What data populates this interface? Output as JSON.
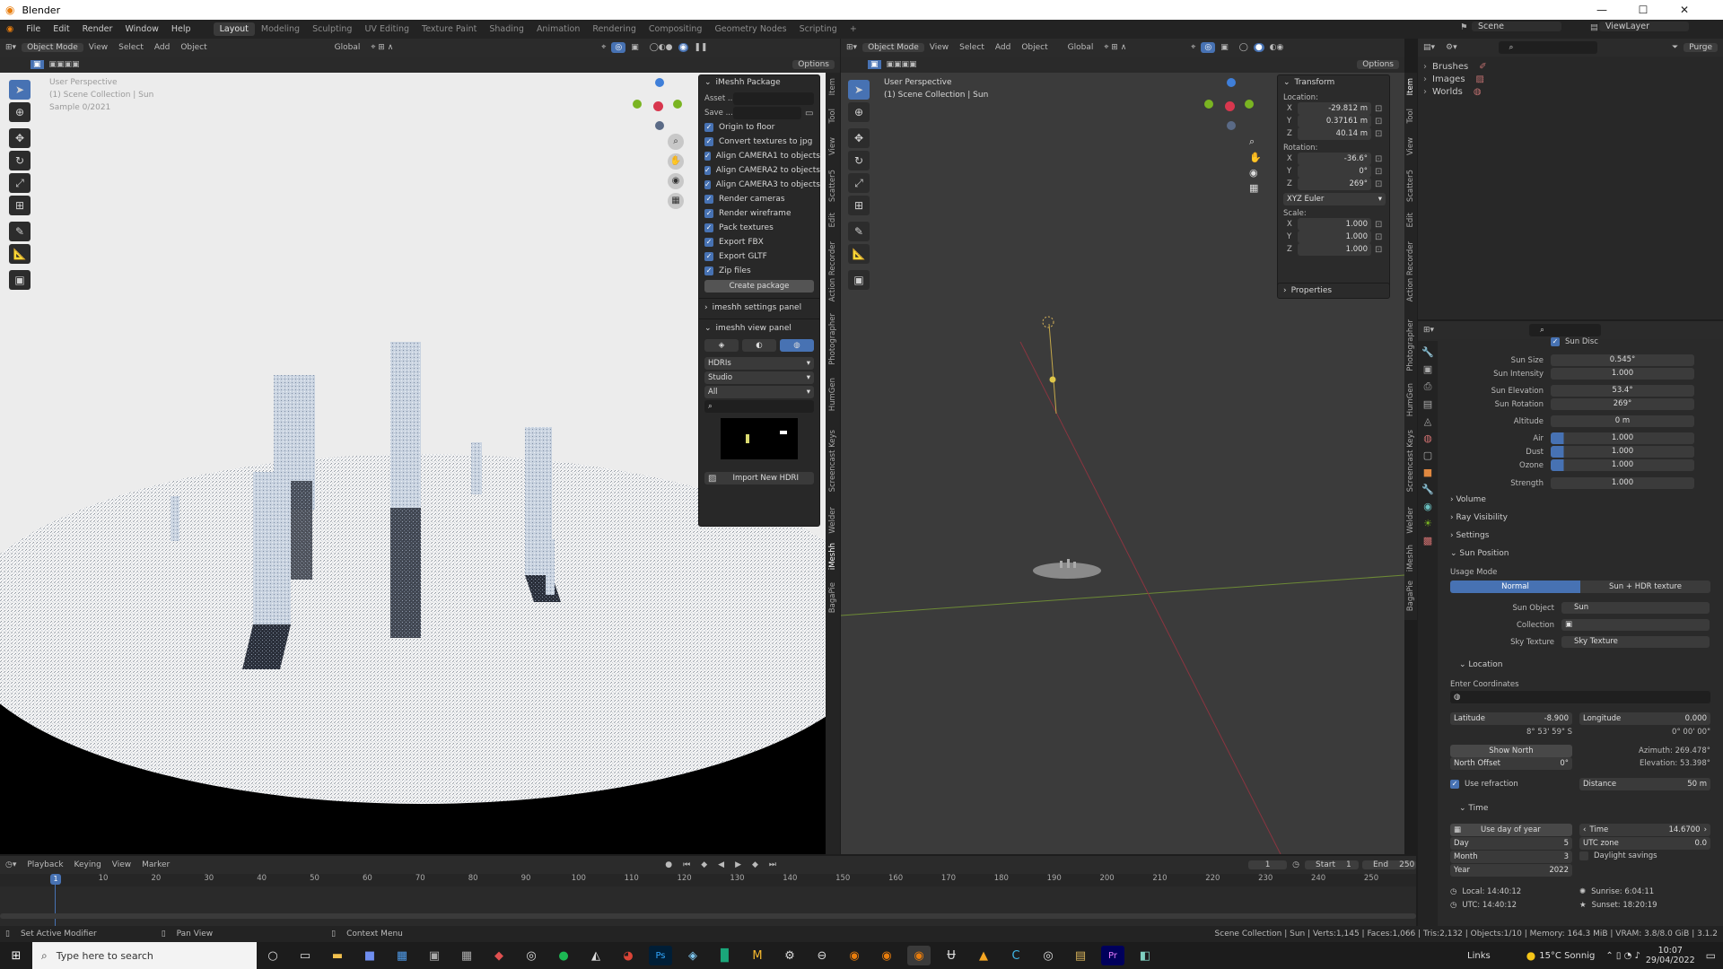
{
  "window": {
    "title": "Blender",
    "minimize": "—",
    "maximize": "☐",
    "close": "✕"
  },
  "menu": {
    "items": [
      "File",
      "Edit",
      "Render",
      "Window",
      "Help"
    ],
    "workspaces": [
      "Layout",
      "Modeling",
      "Sculpting",
      "UV Editing",
      "Texture Paint",
      "Shading",
      "Animation",
      "Rendering",
      "Compositing",
      "Geometry Nodes",
      "Scripting",
      "+"
    ],
    "scene": "Scene",
    "view_layer": "ViewLayer"
  },
  "left_viewport": {
    "header": {
      "mode": "Object Mode",
      "menus": [
        "View",
        "Select",
        "Add",
        "Object"
      ],
      "orientation": "Global",
      "options": "Options"
    },
    "overlay": {
      "line1": "User Perspective",
      "line2": "(1) Scene Collection | Sun",
      "line3": "Sample 0/2021"
    }
  },
  "imeshh": {
    "title": "iMeshh Package",
    "asset_label": "Asset ...",
    "save_label": "Save ...",
    "options": [
      "Origin to floor",
      "Convert textures to jpg",
      "Align CAMERA1 to objects",
      "Align CAMERA2 to objects",
      "Align CAMERA3 to objects",
      "Render cameras",
      "Render wireframe",
      "Pack textures",
      "Export FBX",
      "Export GLTF",
      "Zip files"
    ],
    "create_button": "Create package",
    "settings_panel": "imeshh settings panel",
    "view_panel": "imeshh view panel",
    "hdri_select": "HDRIs",
    "studio_select": "Studio",
    "all_select": "All",
    "import_button": "Import New HDRI"
  },
  "left_tabs": [
    "Item",
    "Tool",
    "View",
    "Scatter5",
    "Edit",
    "Action Recorder",
    "Photographer",
    "HumGen",
    "Screencast Keys",
    "Welder",
    "iMeshh",
    "BagaPie"
  ],
  "right_viewport": {
    "header": {
      "mode": "Object Mode",
      "menus": [
        "View",
        "Select",
        "Add",
        "Object"
      ],
      "orientation": "Global",
      "options": "Options"
    },
    "overlay": {
      "line1": "User Perspective",
      "line2": "(1) Scene Collection | Sun"
    }
  },
  "transform": {
    "title": "Transform",
    "location_label": "Location:",
    "location": [
      {
        "axis": "X",
        "value": "-29.812 m"
      },
      {
        "axis": "Y",
        "value": "0.37161 m"
      },
      {
        "axis": "Z",
        "value": "40.14 m"
      }
    ],
    "rotation_label": "Rotation:",
    "rotation": [
      {
        "axis": "X",
        "value": "-36.6°"
      },
      {
        "axis": "Y",
        "value": "0°"
      },
      {
        "axis": "Z",
        "value": "269°"
      }
    ],
    "rotation_mode": "XYZ Euler",
    "scale_label": "Scale:",
    "scale": [
      {
        "axis": "X",
        "value": "1.000"
      },
      {
        "axis": "Y",
        "value": "1.000"
      },
      {
        "axis": "Z",
        "value": "1.000"
      }
    ],
    "properties": "Properties"
  },
  "right_tabs": [
    "Item",
    "Tool",
    "View",
    "Scatter5",
    "Edit",
    "Action Recorder",
    "Photographer",
    "HumGen",
    "Screencast Keys",
    "Welder",
    "iMeshh",
    "BagaPie"
  ],
  "outliner": {
    "items": [
      "Brushes",
      "Images",
      "Worlds"
    ],
    "purge": "Purge"
  },
  "props": {
    "sun_disc": "Sun Disc",
    "rows": [
      {
        "label": "Sun Size",
        "value": "0.545°"
      },
      {
        "label": "Sun Intensity",
        "value": "1.000"
      },
      {
        "label": "Sun Elevation",
        "value": "53.4°"
      },
      {
        "label": "Sun Rotation",
        "value": "269°"
      },
      {
        "label": "Altitude",
        "value": "0 m"
      },
      {
        "label": "Air",
        "value": "1.000"
      },
      {
        "label": "Dust",
        "value": "1.000"
      },
      {
        "label": "Ozone",
        "value": "1.000"
      },
      {
        "label": "Strength",
        "value": "1.000"
      }
    ],
    "sections": [
      "Volume",
      "Ray Visibility",
      "Settings",
      "Sun Position"
    ],
    "usage_mode_label": "Usage Mode",
    "usage_normal": "Normal",
    "usage_hdr": "Sun + HDR texture",
    "sun_object_label": "Sun Object",
    "sun_object": "Sun",
    "collection_label": "Collection",
    "sky_texture_label": "Sky Texture",
    "sky_texture": "Sky Texture",
    "location_section": "Location",
    "enter_coordinates": "Enter Coordinates",
    "latitude_label": "Latitude",
    "latitude": "-8.900",
    "latitude_dms": "8° 53' 59\" S",
    "longitude_label": "Longitude",
    "longitude": "0.000",
    "longitude_dms": "0° 00' 00\"",
    "show_north": "Show North",
    "north_offset_label": "North Offset",
    "north_offset": "0°",
    "azimuth": "Azimuth: 269.478°",
    "elevation": "Elevation: 53.398°",
    "use_refraction": "Use refraction",
    "distance_label": "Distance",
    "distance": "50 m",
    "time_section": "Time",
    "use_day_of_year": "Use day of year",
    "day_label": "Day",
    "day": "5",
    "month_label": "Month",
    "month": "3",
    "year_label": "Year",
    "year": "2022",
    "time_label": "Time",
    "time": "14.6700",
    "utc_zone_label": "UTC zone",
    "utc_zone": "0.0",
    "daylight_savings": "Daylight savings",
    "local": "Local: 14:40:12",
    "utc": "UTC: 14:40:12",
    "sunrise": "Sunrise: 6:04:11",
    "sunset": "Sunset: 18:20:19"
  },
  "timeline": {
    "menus": [
      "Playback",
      "Keying",
      "View",
      "Marker"
    ],
    "current_frame": "1",
    "start_label": "Start",
    "start": "1",
    "end_label": "End",
    "end": "250",
    "ticks": [
      "1",
      "10",
      "20",
      "30",
      "40",
      "50",
      "60",
      "70",
      "80",
      "90",
      "100",
      "110",
      "120",
      "130",
      "140",
      "150",
      "160",
      "170",
      "180",
      "190",
      "200",
      "210",
      "220",
      "230",
      "240",
      "250"
    ]
  },
  "status": {
    "left1": "Set Active Modifier",
    "left2": "Pan View",
    "left3": "Context Menu",
    "right": "Scene Collection | Sun | Verts:1,145 | Faces:1,066 | Tris:2,132 | Objects:1/10 | Memory: 164.3 MiB | VRAM: 3.8/8.0 GiB | 3.1.2"
  },
  "taskbar": {
    "search_placeholder": "Type here to search",
    "links": "Links",
    "weather": "15°C Sonnig",
    "time": "10:07",
    "date": "29/04/2022"
  },
  "colors": {
    "accent": "#4772b3",
    "axis_x": "#d8374e",
    "axis_y": "#7ab422",
    "axis_z": "#3f7fd9"
  }
}
